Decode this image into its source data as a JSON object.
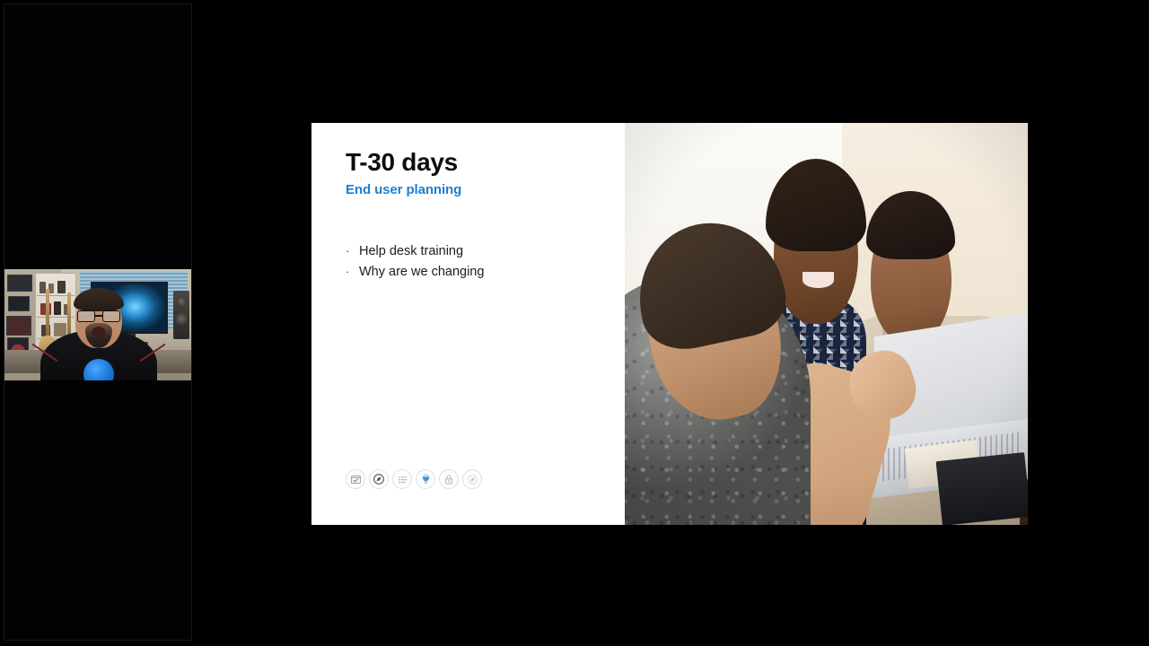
{
  "app": {
    "background_color": "#000000",
    "mode": "screen-share-presentation"
  },
  "participant_panel": {
    "name": "participant-video-column",
    "background_color": "#020202",
    "webcam": {
      "label": "presenter-webcam",
      "description": "Man with glasses, goatee and dark shirt speaking in a home office with guitars, shelving, framed art and a monitor behind him",
      "mic_color": "#1874d6"
    }
  },
  "slide": {
    "background_color": "#ffffff",
    "title": "T-30 days",
    "subtitle": "End user planning",
    "subtitle_color": "#1b7fd2",
    "bullet_char": "·",
    "bullets": [
      "Help desk training",
      "Why are we changing"
    ],
    "icons": [
      {
        "name": "checklist-icon",
        "color": "#8a9199"
      },
      {
        "name": "compass-icon",
        "color": "#4a5058"
      },
      {
        "name": "bullet-list-icon",
        "color": "#aeb6bf"
      },
      {
        "name": "lightbulb-icon",
        "color": "#4a90d9"
      },
      {
        "name": "padlock-icon",
        "color": "#a9b0b8"
      },
      {
        "name": "compass-faded-icon",
        "color": "#c6cdd4"
      }
    ],
    "photo": {
      "label": "collaboration-photo",
      "description": "Three colleagues gathered around a Surface laptop at a wooden table, smiling and reviewing the screen together"
    }
  }
}
